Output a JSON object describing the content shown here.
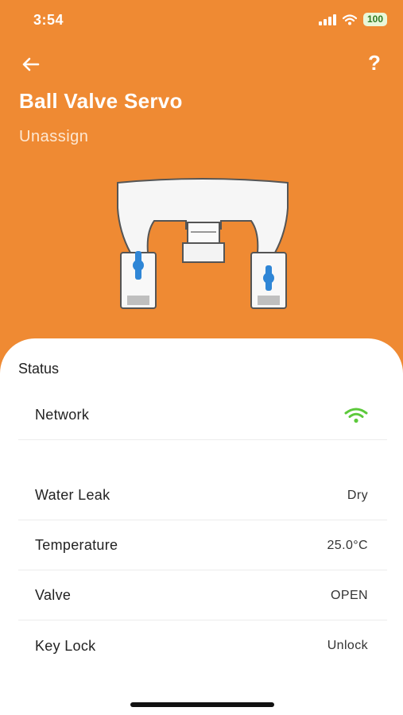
{
  "status_bar": {
    "time": "3:54",
    "battery": "100"
  },
  "header": {
    "title": "Ball Valve Servo",
    "unassign_label": "Unassign",
    "help_label": "?"
  },
  "status_section": {
    "title": "Status",
    "rows": [
      {
        "label": "Network",
        "value": "",
        "icon": "wifi-icon",
        "icon_color": "#5cc93b"
      },
      {
        "label": "Water Leak",
        "value": "Dry"
      },
      {
        "label": "Temperature",
        "value": "25.0°C"
      },
      {
        "label": "Valve",
        "value": "OPEN"
      },
      {
        "label": "Key Lock",
        "value": "Unlock"
      }
    ]
  },
  "colors": {
    "hero": "#ef8a33",
    "accent_valve": "#2f86d6"
  }
}
